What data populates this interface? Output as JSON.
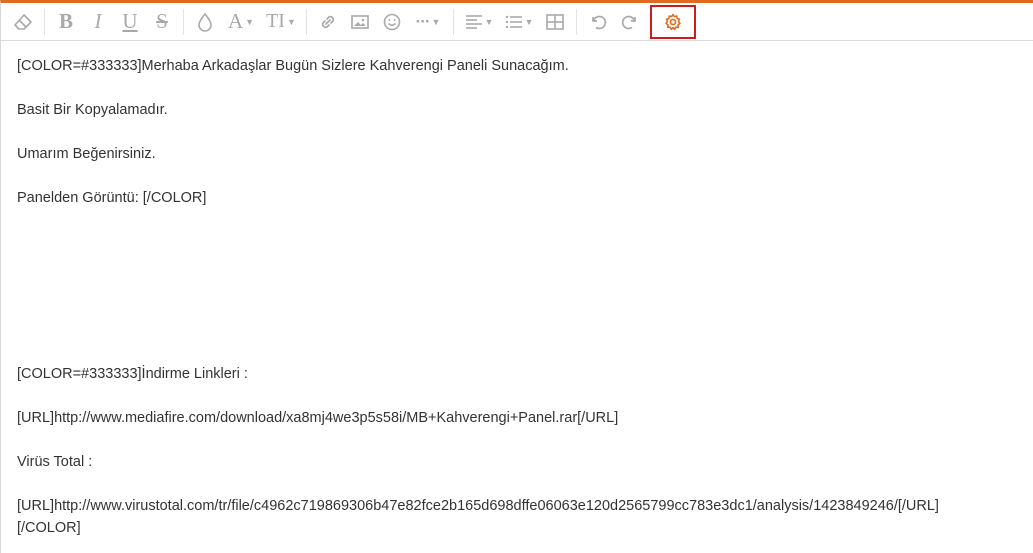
{
  "toolbar": {
    "buttons": [
      {
        "name": "eraser-icon"
      },
      {
        "name": "bold-button",
        "glyph": "B"
      },
      {
        "name": "italic-button",
        "glyph": "I"
      },
      {
        "name": "underline-button",
        "glyph": "U"
      },
      {
        "name": "strikethrough-button",
        "glyph": "S"
      },
      {
        "name": "color-drop-icon"
      },
      {
        "name": "font-family-button",
        "glyph": "A"
      },
      {
        "name": "font-size-button",
        "glyph": "TI"
      },
      {
        "name": "link-icon"
      },
      {
        "name": "image-icon"
      },
      {
        "name": "smiley-icon"
      },
      {
        "name": "more-icon",
        "glyph": "···"
      },
      {
        "name": "align-icon"
      },
      {
        "name": "list-icon"
      },
      {
        "name": "table-icon"
      },
      {
        "name": "undo-icon"
      },
      {
        "name": "redo-icon"
      },
      {
        "name": "settings-gear-icon"
      }
    ],
    "accent_color": "#e06b1f",
    "highlight_color": "#d11a1a"
  },
  "content": {
    "line1": "[COLOR=#333333]Merhaba Arkadaşlar Bugün Sizlere Kahverengi Paneli Sunacağım.",
    "line2": "Basit Bir Kopyalamadır.",
    "line3": "Umarım Beğenirsiniz.",
    "line4": "Panelden Görüntü: [/COLOR]",
    "line5": "[COLOR=#333333]İndirme Linkleri :",
    "line6": "[URL]http://www.mediafire.com/download/xa8mj4we3p5s58i/MB+Kahverengi+Panel.rar[/URL]",
    "line7": "Virüs Total :",
    "line8": "[URL]http://www.virustotal.com/tr/file/c4962c719869306b47e82fce2b165d698dffe06063e120d2565799cc783e3dc1/analysis/1423849246/[/URL]",
    "line9": "[/COLOR]"
  }
}
